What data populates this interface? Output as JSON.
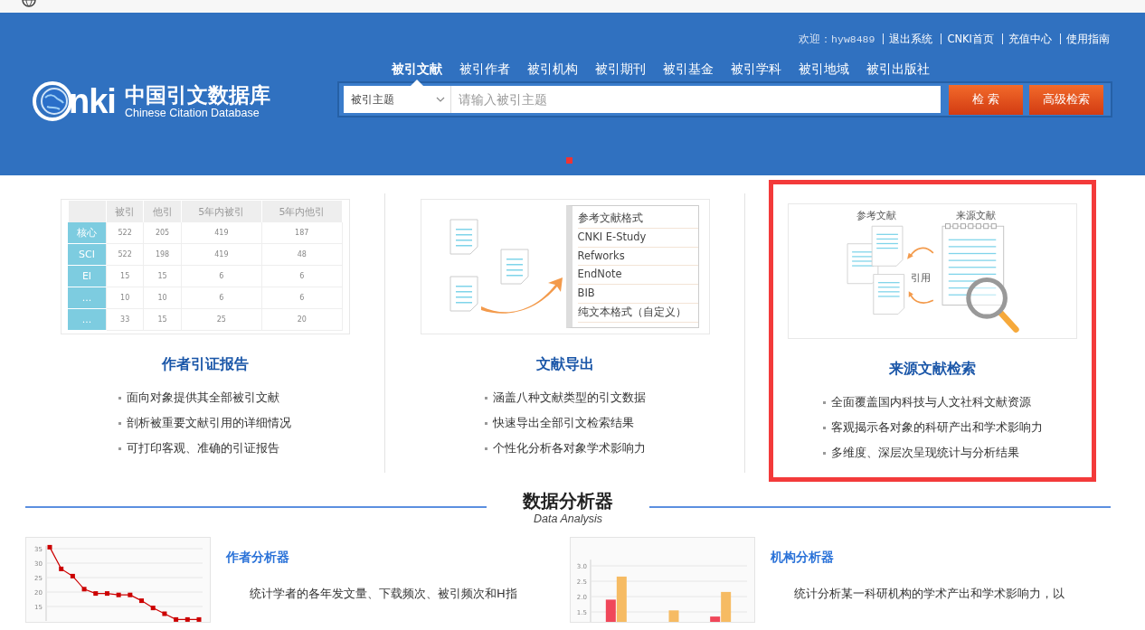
{
  "header": {
    "user_links": [
      {
        "label": "欢迎：hyw8489",
        "kind": "text"
      },
      {
        "label": "退出系统",
        "kind": "link"
      },
      {
        "label": "CNKI首页",
        "kind": "link"
      },
      {
        "label": "充值中心",
        "kind": "link"
      },
      {
        "label": "使用指南",
        "kind": "link"
      }
    ],
    "logo": {
      "mark": "nki",
      "title": "中国引文数据库",
      "subtitle": "Chinese Citation Database"
    },
    "tabs": [
      {
        "label": "被引文献",
        "selected": true
      },
      {
        "label": "被引作者",
        "selected": false
      },
      {
        "label": "被引机构",
        "selected": false
      },
      {
        "label": "被引期刊",
        "selected": false
      },
      {
        "label": "被引基金",
        "selected": false
      },
      {
        "label": "被引学科",
        "selected": false
      },
      {
        "label": "被引地域",
        "selected": false
      },
      {
        "label": "被引出版社",
        "selected": false
      }
    ],
    "search": {
      "scope": "被引主题",
      "placeholder": "请输入被引主题",
      "buttons": [
        "检 索",
        "高级检索"
      ]
    }
  },
  "features": [
    {
      "kind": "table",
      "highlighted": false,
      "table": {
        "columns": [
          "被引",
          "他引",
          "5年内被引",
          "5年内他引"
        ],
        "rows": [
          {
            "head": "核心",
            "cells": [
              "522",
              "205",
              "419",
              "187"
            ]
          },
          {
            "head": "SCI",
            "cells": [
              "522",
              "198",
              "419",
              "48"
            ]
          },
          {
            "head": "EI",
            "cells": [
              "15",
              "15",
              "6",
              "6"
            ]
          },
          {
            "head": "...",
            "cells": [
              "10",
              "10",
              "6",
              "6"
            ]
          },
          {
            "head": "...",
            "cells": [
              "33",
              "15",
              "25",
              "20"
            ]
          }
        ]
      },
      "title": "作者引证报告",
      "points": [
        "面向对象提供其全部被引文献",
        "剖析被重要文献引用的详细情况",
        "可打印客观、准确的引证报告"
      ]
    },
    {
      "kind": "export",
      "highlighted": false,
      "formats": [
        "参考文献格式",
        "CNKI E-Study",
        "Refworks",
        "EndNote",
        "BIB",
        "纯文本格式（自定义）"
      ],
      "title": "文献导出",
      "points": [
        "涵盖八种文献类型的引文数据",
        "快速导出全部引文检索结果",
        "个性化分析各对象学术影响力"
      ]
    },
    {
      "kind": "source",
      "highlighted": true,
      "labels": [
        "参考文献",
        "来源文献",
        "引用"
      ],
      "title": "来源文献检索",
      "points": [
        "全面覆盖国内科技与人文社科文献资源",
        "客观揭示各对象的科研产出和学术影响力",
        "多维度、深层次呈现统计与分析结果"
      ]
    }
  ],
  "analysis": {
    "title": "数据分析器",
    "subtitle": "Data Analysis",
    "cards": [
      {
        "title": "作者分析器",
        "text": "统计学者的各年发文量、下载频次、被引频次和H指",
        "chart_data": {
          "type": "line",
          "grid": true,
          "ylim": [
            10,
            36
          ],
          "yticks": [
            15,
            20,
            25,
            30,
            35
          ],
          "series": [
            {
              "color": "#cc0000",
              "marker": "square",
              "values": [
                35.5,
                28,
                25.5,
                21,
                19.5,
                19.5,
                19,
                19,
                17,
                14.5,
                12.5,
                10.5,
                10.5,
                10.5
              ]
            }
          ]
        }
      },
      {
        "title": "机构分析器",
        "text": "统计分析某一科研机构的学术产出和学术影响力，以",
        "chart_data": {
          "type": "bar",
          "grid": true,
          "ylim": [
            0,
            3.2
          ],
          "yticks": [
            {
              "value": 1.5,
              "label": "1.5"
            },
            {
              "value": 2,
              "label": "2.0"
            },
            {
              "value": 2.5,
              "label": "2.5"
            },
            {
              "value": 3,
              "label": "3.0"
            }
          ],
          "series": [
            {
              "color": "#f0475a",
              "values": [
                1.9,
                null,
                1.35
              ]
            },
            {
              "color": "#f6bb63",
              "values": [
                2.65,
                1.55,
                2.15
              ]
            }
          ]
        }
      }
    ]
  }
}
